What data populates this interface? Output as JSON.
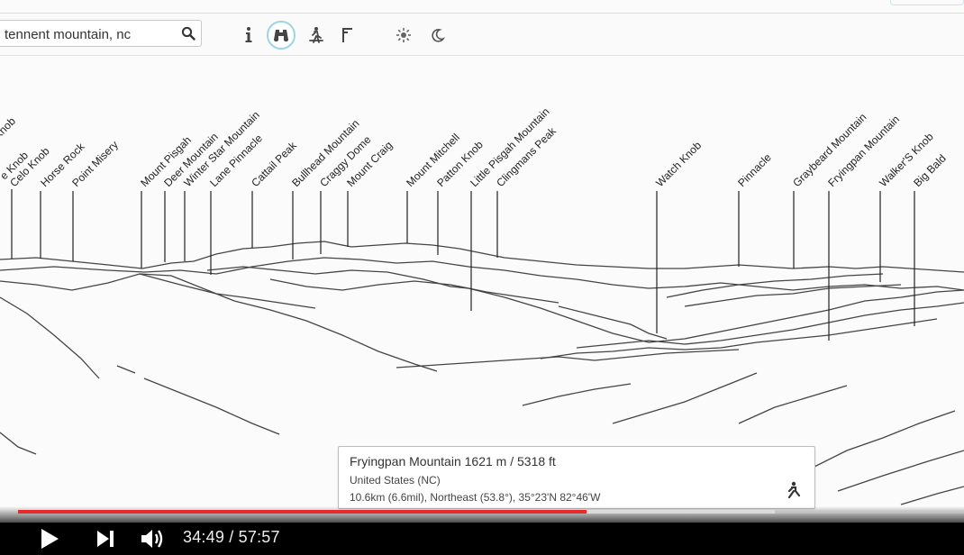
{
  "search": {
    "value": "tennent mountain, nc"
  },
  "toolbar": {
    "tools": [
      {
        "icon": "info-icon",
        "active": false
      },
      {
        "icon": "binoculars-icon",
        "active": true
      },
      {
        "icon": "hiker-icon",
        "active": false
      },
      {
        "icon": "flag-icon",
        "active": false
      },
      {
        "icon": "sun-icon",
        "active": false
      },
      {
        "icon": "moon-icon",
        "active": false
      }
    ]
  },
  "peaks": [
    "Knob",
    "e Knob",
    "Celo Knob",
    "Horse Rock",
    "Point Misery",
    "Mount Pisgah",
    "Deer Mountain",
    "Winter Star Mountain",
    "Lane Pinnacle",
    "Cattail Peak",
    "Bullhead Mountain",
    "Craggy Dome",
    "Mount Craig",
    "Mount Mitchell",
    "Patton Knob",
    "Little Pisgah Mountain",
    "Clingmans Peak",
    "Watch Knob",
    "Pinnacle",
    "Graybeard Mountain",
    "Fryingpan Mountain",
    "Walker'S Knob",
    "Big Bald"
  ],
  "info_card": {
    "name": "Fryingpan Mountain 1621 m / 5318 ft",
    "country": "United States (NC)",
    "details": "10.6km (6.6mil), Northeast (53.8°), 35°23'N 82°46'W"
  },
  "player": {
    "current_time": "34:49",
    "duration": "57:57",
    "time_display": "34:49 / 57:57",
    "progress_fraction": 0.6008,
    "buffered_fraction": 0.8,
    "progress_color": "#e52b2b"
  }
}
